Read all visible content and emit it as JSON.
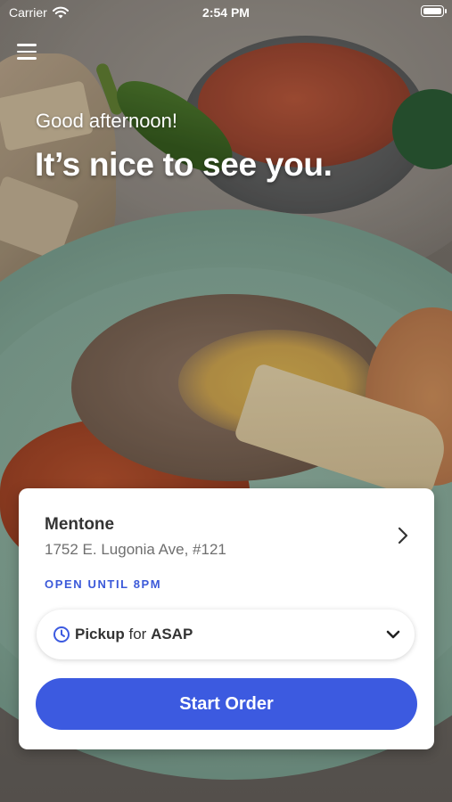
{
  "status_bar": {
    "carrier": "Carrier",
    "time": "2:54 PM"
  },
  "header": {
    "greeting": "Good afternoon!",
    "headline": "It’s nice to see you."
  },
  "location": {
    "name": "Mentone",
    "address": "1752 E. Lugonia Ave, #121",
    "hours_status": "OPEN UNTIL 8PM"
  },
  "order_mode": {
    "mode": "Pickup",
    "connector": "for",
    "time": "ASAP"
  },
  "actions": {
    "start_order": "Start Order"
  },
  "colors": {
    "accent": "#3c5ae0",
    "status_text": "#3b59d9"
  },
  "icons": [
    "hamburger-menu-icon",
    "wifi-icon",
    "battery-icon",
    "chevron-right-icon",
    "clock-icon",
    "chevron-down-icon"
  ]
}
